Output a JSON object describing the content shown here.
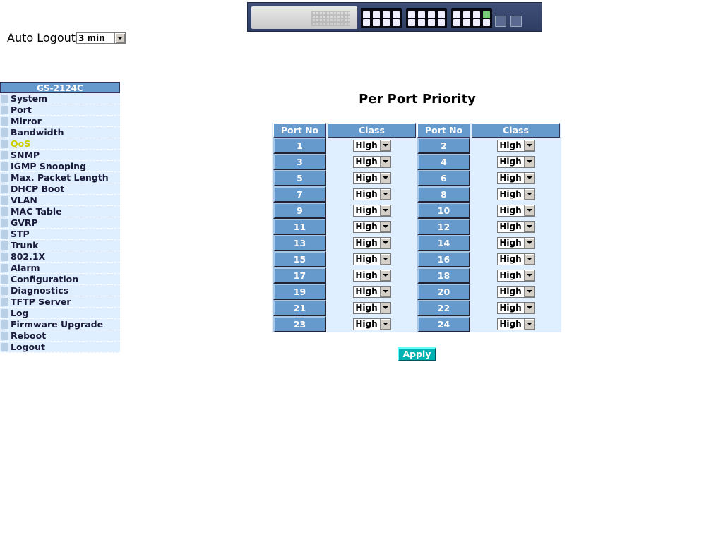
{
  "auto_logout": {
    "label": "Auto Logout",
    "selected": "3 min"
  },
  "sidebar": {
    "header": "GS-2124C",
    "items": [
      {
        "label": "System"
      },
      {
        "label": "Port"
      },
      {
        "label": "Mirror"
      },
      {
        "label": "Bandwidth"
      },
      {
        "label": "QoS",
        "active": true
      },
      {
        "label": "SNMP"
      },
      {
        "label": "IGMP Snooping"
      },
      {
        "label": "Max. Packet Length"
      },
      {
        "label": "DHCP Boot"
      },
      {
        "label": "VLAN"
      },
      {
        "label": "MAC Table"
      },
      {
        "label": "GVRP"
      },
      {
        "label": "STP"
      },
      {
        "label": "Trunk"
      },
      {
        "label": "802.1X"
      },
      {
        "label": "Alarm"
      },
      {
        "label": "Configuration"
      },
      {
        "label": "Diagnostics"
      },
      {
        "label": "TFTP Server"
      },
      {
        "label": "Log"
      },
      {
        "label": "Firmware Upgrade"
      },
      {
        "label": "Reboot"
      },
      {
        "label": "Logout"
      }
    ]
  },
  "main": {
    "title": "Per Port Priority",
    "headers": [
      "Port No",
      "Class",
      "Port No",
      "Class"
    ],
    "rows": [
      {
        "left_port": "1",
        "left_class": "High",
        "right_port": "2",
        "right_class": "High"
      },
      {
        "left_port": "3",
        "left_class": "High",
        "right_port": "4",
        "right_class": "High"
      },
      {
        "left_port": "5",
        "left_class": "High",
        "right_port": "6",
        "right_class": "High"
      },
      {
        "left_port": "7",
        "left_class": "High",
        "right_port": "8",
        "right_class": "High"
      },
      {
        "left_port": "9",
        "left_class": "High",
        "right_port": "10",
        "right_class": "High"
      },
      {
        "left_port": "11",
        "left_class": "High",
        "right_port": "12",
        "right_class": "High"
      },
      {
        "left_port": "13",
        "left_class": "High",
        "right_port": "14",
        "right_class": "High"
      },
      {
        "left_port": "15",
        "left_class": "High",
        "right_port": "16",
        "right_class": "High"
      },
      {
        "left_port": "17",
        "left_class": "High",
        "right_port": "18",
        "right_class": "High"
      },
      {
        "left_port": "19",
        "left_class": "High",
        "right_port": "20",
        "right_class": "High"
      },
      {
        "left_port": "21",
        "left_class": "High",
        "right_port": "22",
        "right_class": "High"
      },
      {
        "left_port": "23",
        "left_class": "High",
        "right_port": "24",
        "right_class": "High"
      }
    ],
    "apply_label": "Apply"
  },
  "colors": {
    "header_blue": "#6699cc",
    "row_bg": "#dfefff",
    "apply_bg": "#00b3b3",
    "active_menu": "#cccc00"
  },
  "icons": {
    "banner": "switch-front-panel-image",
    "dropdown": "dropdown-arrow-icon"
  }
}
